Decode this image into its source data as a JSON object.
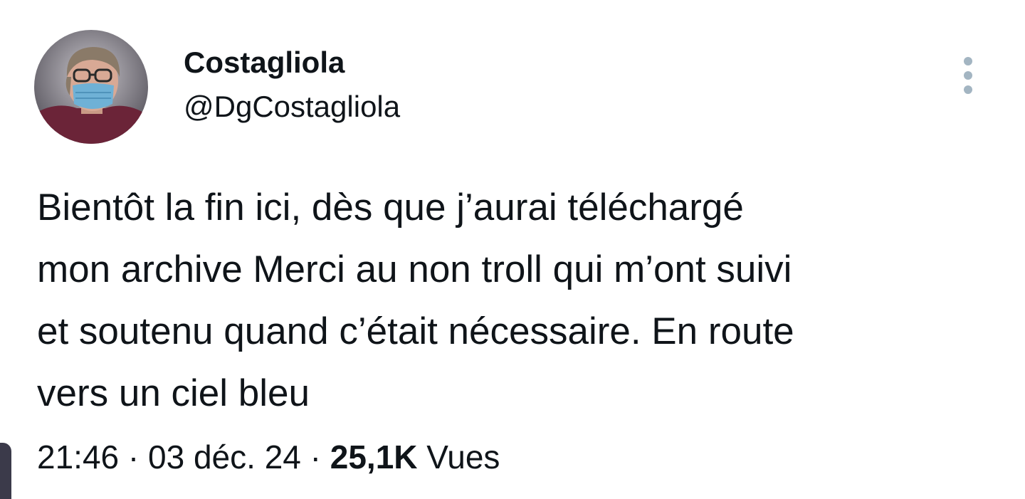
{
  "tweet": {
    "author": {
      "display_name": "Costagliola",
      "handle": "@DgCostagliola",
      "avatar_icon": "profile-photo-masked-person"
    },
    "more_icon": "vertical-ellipsis-icon",
    "text_lines": [
      "Bientôt la fin ici, dès que j’aurai téléchargé",
      "mon archive Merci au non troll qui m’ont suivi",
      "et soutenu quand c’était nécessaire. En route",
      "vers un ciel bleu"
    ],
    "time": "21:46",
    "separator": "·",
    "date": "03 déc. 24",
    "views_count": "25,1K",
    "views_label": "Vues"
  },
  "colors": {
    "text": "#0f1419",
    "muted_dots": "#a3b5c2",
    "background": "#ffffff"
  }
}
